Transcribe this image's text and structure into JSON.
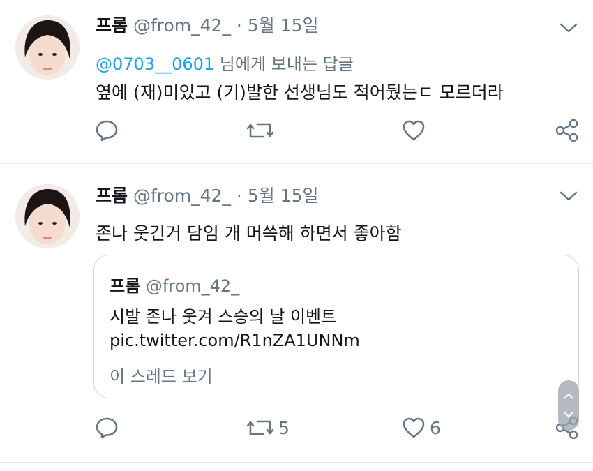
{
  "tweets": [
    {
      "name": "프롬",
      "handle": "@from_42_",
      "separator": "·",
      "date": "5월 15일",
      "reply_to": "@0703__0601",
      "reply_suffix": " 님에게 보내는 답글",
      "text": "옆에 (재)미있고 (기)발한 선생님도 적어뒀는ㄷ 모르더라",
      "actions": {
        "reply_icon": "reply-icon",
        "retweet_icon": "retweet-icon",
        "like_icon": "heart-icon",
        "share_icon": "share-icon"
      }
    },
    {
      "name": "프롬",
      "handle": "@from_42_",
      "separator": "·",
      "date": "5월 15일",
      "text": "존나 웃긴거 담임 개 머쓱해 하면서 좋아함",
      "quote": {
        "name": "프롬",
        "handle": "@from_42_",
        "line1": "시발 존나 웃겨 스승의 날 이벤트",
        "line2": "pic.twitter.com/R1nZA1UNNm",
        "thread_link": "이 스레드 보기"
      },
      "actions": {
        "retweets": "5",
        "likes": "6"
      }
    }
  ],
  "colors": {
    "accent": "#1da1f2",
    "secondary_text": "#657786",
    "border": "#e6ecf0"
  }
}
